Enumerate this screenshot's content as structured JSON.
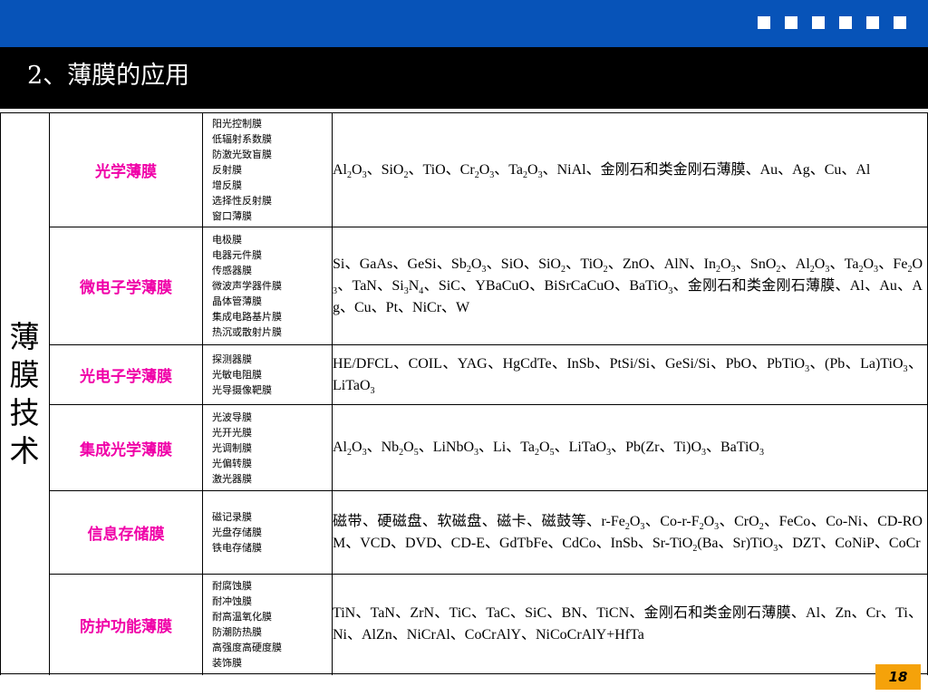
{
  "header": {
    "title": "2、薄膜的应用",
    "bar_color": "#0753b8",
    "square_count": 6
  },
  "big_label": "薄膜技术",
  "rows": [
    {
      "category": "光学薄膜",
      "types": [
        "阳光控制膜",
        "低辐射系数膜",
        "防激光致盲膜",
        "反射膜",
        "增反膜",
        "选择性反射膜",
        "窗口薄膜"
      ],
      "materials": [
        [
          "Al"
        ],
        [
          "2",
          "sub"
        ],
        [
          "O"
        ],
        [
          "3",
          "sub"
        ],
        [
          "、SiO"
        ],
        [
          "2",
          "sub"
        ],
        [
          "、TiO、Cr"
        ],
        [
          "2",
          "sub"
        ],
        [
          "O"
        ],
        [
          "3",
          "sub"
        ],
        [
          "、Ta"
        ],
        [
          "2",
          "sub"
        ],
        [
          "O"
        ],
        [
          "3",
          "sub"
        ],
        [
          "、NiAl、金刚石和类金刚石薄膜、Au、Ag、Cu、Al"
        ]
      ]
    },
    {
      "category": "微电子学薄膜",
      "types": [
        "电极膜",
        "电器元件膜",
        "传感器膜",
        "微波声学器件膜",
        "晶体管薄膜",
        "集成电路基片膜",
        "热沉或散射片膜"
      ],
      "materials": [
        [
          "Si、GaAs、GeSi、Sb"
        ],
        [
          "2",
          "sub"
        ],
        [
          "O"
        ],
        [
          "3",
          "sub"
        ],
        [
          "、SiO、SiO"
        ],
        [
          "2",
          "sub"
        ],
        [
          "、TiO"
        ],
        [
          "2",
          "sub"
        ],
        [
          "、ZnO、AlN、In"
        ],
        [
          "2",
          "sub"
        ],
        [
          "O"
        ],
        [
          "3",
          "sub"
        ],
        [
          "、SnO"
        ],
        [
          "2",
          "sub"
        ],
        [
          "、Al"
        ],
        [
          "2",
          "sub"
        ],
        [
          "O"
        ],
        [
          "3",
          "sub"
        ],
        [
          "、Ta"
        ],
        [
          "2",
          "sub"
        ],
        [
          "O"
        ],
        [
          "3",
          "sub"
        ],
        [
          "、Fe"
        ],
        [
          "2",
          "sub"
        ],
        [
          "O"
        ],
        [
          "3",
          "sub"
        ],
        [
          "、TaN、Si"
        ],
        [
          "3",
          "sub"
        ],
        [
          "N"
        ],
        [
          "4",
          "sub"
        ],
        [
          "、SiC、YBaCuO、BiSrCaCuO、BaTiO"
        ],
        [
          "3",
          "sub"
        ],
        [
          "、金刚石和类金刚石薄膜、Al、Au、Ag、Cu、Pt、NiCr、W"
        ]
      ]
    },
    {
      "category": "光电子学薄膜",
      "types": [
        "探测器膜",
        "光敏电阻膜",
        "光导摄像靶膜"
      ],
      "materials": [
        [
          "HE/DFCL、COIL、YAG、HgCdTe、InSb、PtSi/Si、GeSi/Si、PbO、PbTiO"
        ],
        [
          "3",
          "sub"
        ],
        [
          "、(Pb、La)TiO"
        ],
        [
          "3",
          "sub"
        ],
        [
          "、LiTaO"
        ],
        [
          "3",
          "sub"
        ]
      ]
    },
    {
      "category": "集成光学薄膜",
      "types": [
        "光波导膜",
        "光开光膜",
        "光调制膜",
        "光偏转膜",
        "激光器膜"
      ],
      "materials": [
        [
          "Al"
        ],
        [
          "2",
          "sub"
        ],
        [
          "O"
        ],
        [
          "3",
          "sub"
        ],
        [
          "、Nb"
        ],
        [
          "2",
          "sub"
        ],
        [
          "O"
        ],
        [
          "5",
          "sub"
        ],
        [
          "、LiNbO"
        ],
        [
          "3",
          "sub"
        ],
        [
          "、Li、Ta"
        ],
        [
          "2",
          "sub"
        ],
        [
          "O"
        ],
        [
          "5",
          "sub"
        ],
        [
          "、LiTaO"
        ],
        [
          "3",
          "sub"
        ],
        [
          "、Pb(Zr、Ti)O"
        ],
        [
          "3",
          "sub"
        ],
        [
          "、BaTiO"
        ],
        [
          "3",
          "sub"
        ]
      ]
    },
    {
      "category": "信息存储膜",
      "types": [
        "磁记录膜",
        "光盘存储膜",
        "铁电存储膜"
      ],
      "materials": [
        [
          "磁带、硬磁盘、软磁盘、磁卡、磁鼓等、r-Fe"
        ],
        [
          "2",
          "sub"
        ],
        [
          "O"
        ],
        [
          "3",
          "sub"
        ],
        [
          "、Co-r-F"
        ],
        [
          "2",
          "sub"
        ],
        [
          "O"
        ],
        [
          "3",
          "sub"
        ],
        [
          "、CrO"
        ],
        [
          "2",
          "sub"
        ],
        [
          "、FeCo、Co-Ni、CD-ROM、VCD、DVD、CD-E、GdTbFe、CdCo、InSb、Sr-TiO"
        ],
        [
          "2",
          "sub"
        ],
        [
          "(Ba、Sr)TiO"
        ],
        [
          "3",
          "sub"
        ],
        [
          "、DZT、CoNiP、CoCr"
        ]
      ]
    },
    {
      "category": "防护功能薄膜",
      "types": [
        "耐腐蚀膜",
        "耐冲蚀膜",
        "耐高温氧化膜",
        "防潮防热膜",
        "高强度高硬度膜",
        "装饰膜"
      ],
      "materials": [
        [
          "TiN、TaN、ZrN、TiC、TaC、SiC、BN、TiCN、金刚石和类金刚石薄膜、Al、Zn、Cr、Ti、Ni、AlZn、NiCrAl、CoCrAlY、NiCoCrAlY+HfTa"
        ]
      ]
    }
  ],
  "page_number": "18",
  "colors": {
    "category_text": "#f000a8",
    "page_badge": "#f5a20a",
    "title_bar": "#000000"
  }
}
